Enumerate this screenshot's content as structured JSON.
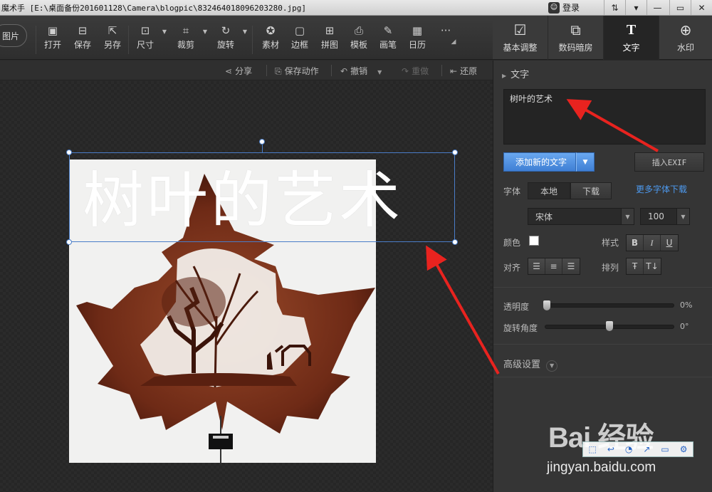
{
  "titlebar": {
    "title": "魔术手  [E:\\桌面备份201601128\\Camera\\blogpic\\832464018096203280.jpg]",
    "login_label": "登录"
  },
  "toolbar": {
    "open_pic_label": "图片",
    "tools": [
      {
        "label": "打开",
        "icon": "open-icon"
      },
      {
        "label": "保存",
        "icon": "save-icon"
      },
      {
        "label": "另存",
        "icon": "saveas-icon"
      },
      {
        "label": "尺寸",
        "icon": "resize-icon"
      },
      {
        "label": "裁剪",
        "icon": "crop-icon"
      },
      {
        "label": "旋转",
        "icon": "rotate-icon"
      },
      {
        "label": "素材",
        "icon": "material-icon"
      },
      {
        "label": "边框",
        "icon": "border-icon"
      },
      {
        "label": "拼图",
        "icon": "collage-icon"
      },
      {
        "label": "模板",
        "icon": "template-icon"
      },
      {
        "label": "画笔",
        "icon": "brush-icon"
      },
      {
        "label": "日历",
        "icon": "calendar-icon"
      }
    ],
    "more_label": "···"
  },
  "right_tabs": [
    {
      "label": "基本调整",
      "icon": "basic-adjust-icon"
    },
    {
      "label": "数码暗房",
      "icon": "darkroom-icon"
    },
    {
      "label": "文字",
      "icon": "text-icon",
      "active": true
    },
    {
      "label": "水印",
      "icon": "watermark-icon"
    }
  ],
  "subbar": {
    "share": "分享",
    "save_action": "保存动作",
    "undo": "撤销",
    "redo": "重做",
    "restore": "还原"
  },
  "canvas": {
    "overlay_text": "树叶的艺术"
  },
  "panel": {
    "section_title": "文字",
    "text_value": "树叶的艺术",
    "add_text_button": "添加新的文字",
    "insert_exif_button": "插入EXIF",
    "font_label": "字体",
    "font_tab_local": "本地",
    "font_tab_download": "下载",
    "more_fonts_link": "更多字体下载",
    "font_name": "宋体",
    "font_size": "100",
    "color_label": "颜色",
    "text_color": "#ffffff",
    "style_label": "样式",
    "style_bold": "B",
    "style_italic": "I",
    "style_underline": "U",
    "align_label": "对齐",
    "arrange_label": "排列",
    "opacity_label": "透明度",
    "opacity_value": "0%",
    "opacity_fraction": 0,
    "rotation_label": "旋转角度",
    "rotation_value": "0°",
    "advanced_label": "高级设置"
  },
  "watermark": {
    "brand": "Bai 经验",
    "url": "jingyan.baidu.com"
  },
  "colors": {
    "accent_blue": "#3f7fd4",
    "arrow_red": "#e8231f",
    "selection_blue": "#4a7dc8"
  }
}
